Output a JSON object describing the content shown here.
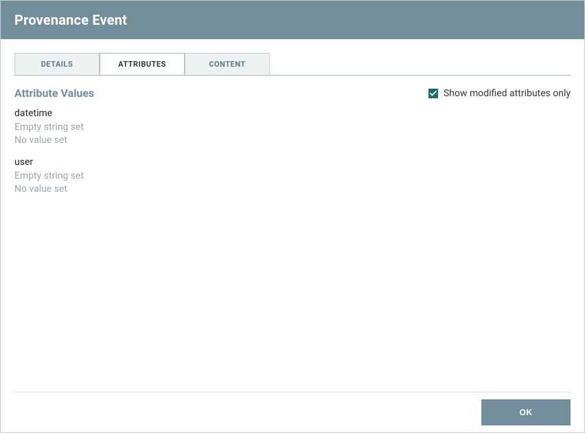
{
  "header": {
    "title": "Provenance Event"
  },
  "tabs": {
    "details": {
      "label": "DETAILS",
      "active": false
    },
    "attributes": {
      "label": "ATTRIBUTES",
      "active": true
    },
    "content": {
      "label": "CONTENT",
      "active": false
    }
  },
  "section": {
    "title": "Attribute Values",
    "toggle_label": "Show modified attributes only",
    "toggle_checked": true
  },
  "attributes": [
    {
      "name": "datetime",
      "line1": "Empty string set",
      "line2": "No value set"
    },
    {
      "name": "user",
      "line1": "Empty string set",
      "line2": "No value set"
    }
  ],
  "footer": {
    "ok_label": "OK"
  }
}
